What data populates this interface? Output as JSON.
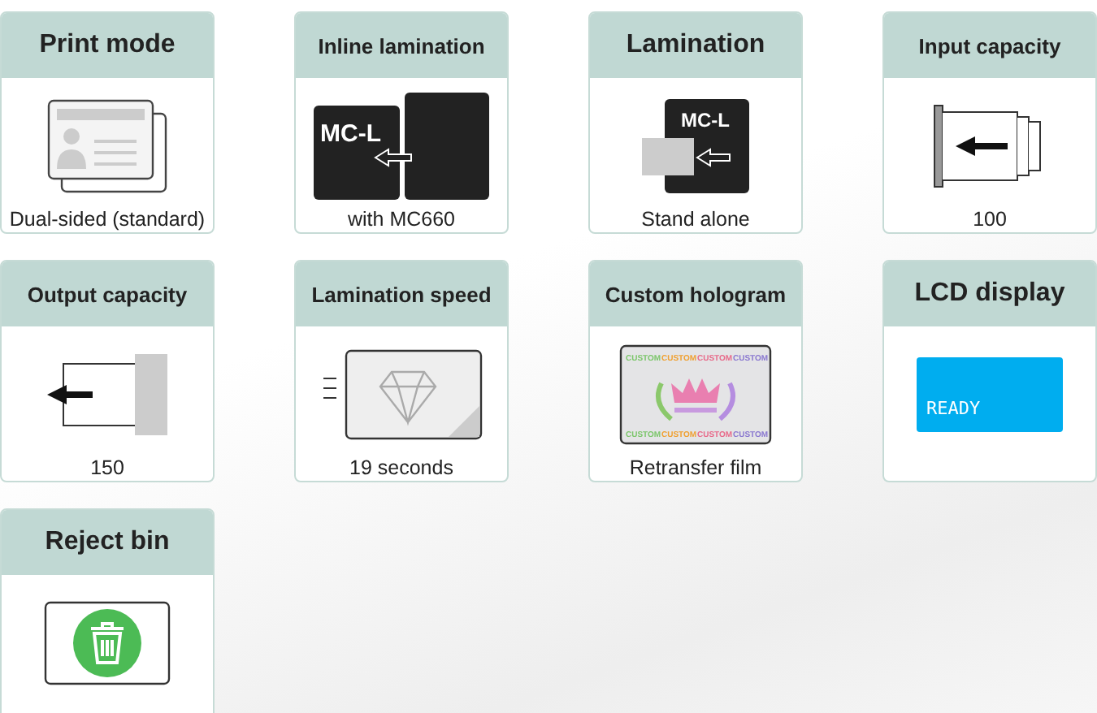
{
  "cards": [
    {
      "title": "Print mode",
      "kind": "id-card",
      "caption": "Dual-sided (standard)"
    },
    {
      "title": "Inline lamination",
      "kind": "inline-lamination",
      "icon_text": "MC-L",
      "caption": "with MC660"
    },
    {
      "title": "Lamination",
      "kind": "lamination",
      "icon_text": "MC-L",
      "caption": "Stand alone"
    },
    {
      "title": "Input capacity",
      "kind": "input-tray",
      "caption": "100"
    },
    {
      "title": "Output capacity",
      "kind": "output-tray",
      "caption": "150"
    },
    {
      "title": "Lamination speed",
      "kind": "speed-card",
      "caption": "19 seconds"
    },
    {
      "title": "Custom hologram",
      "kind": "hologram",
      "icon_texts": [
        "CUSTOM",
        "CUSTOM",
        "CUSTOM",
        "CUSTOM",
        "CUSTOM",
        "CUSTOM",
        "CUSTOM",
        "CUSTOM"
      ],
      "caption": "Retransfer film"
    },
    {
      "title": "LCD display",
      "kind": "lcd",
      "icon_text": "READY"
    },
    {
      "title": "Reject bin",
      "kind": "bin"
    }
  ]
}
